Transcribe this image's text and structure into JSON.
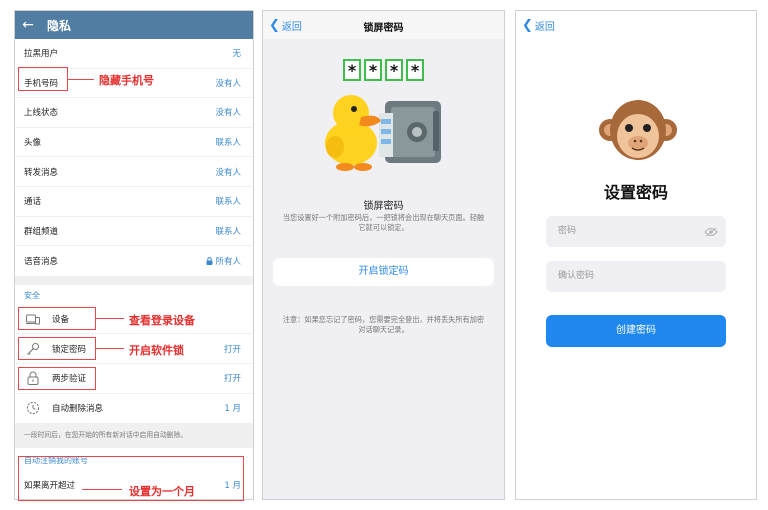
{
  "panel1": {
    "title": "隐私",
    "rows": [
      {
        "label": "拉黑用户",
        "value": "无"
      },
      {
        "label": "手机号码",
        "value": "没有人"
      },
      {
        "label": "上线状态",
        "value": "没有人"
      },
      {
        "label": "头像",
        "value": "联系人"
      },
      {
        "label": "转发消息",
        "value": "没有人"
      },
      {
        "label": "通话",
        "value": "联系人"
      },
      {
        "label": "群组频道",
        "value": "联系人"
      },
      {
        "label": "语音消息",
        "value": "所有人"
      }
    ],
    "security": {
      "title": "安全",
      "items": [
        {
          "label": "设备",
          "value": ""
        },
        {
          "label": "锁定密码",
          "value": "打开"
        },
        {
          "label": "两步验证",
          "value": "打开"
        },
        {
          "label": "自动删除消息",
          "value": "1 月"
        }
      ],
      "note": "一段时间后，在您开始的所有新对话中启用自动删除。"
    },
    "auto_delete": {
      "title": "自动注销我的账号",
      "label": "如果离开超过",
      "value": "1 月"
    },
    "annotations": {
      "hide_phone": "隐藏手机号",
      "check_devices": "查看登录设备",
      "enable_lock": "开启软件锁",
      "set_month": "设置为一个月"
    }
  },
  "panel2": {
    "back": "返回",
    "title": "锁屏密码",
    "pin_chars": [
      "*",
      "*",
      "*",
      "*"
    ],
    "heading": "锁屏密码",
    "description": "当您设置好一个附加密码后，一把锁将会出现在聊天页面。轻触它就可以锁定。",
    "button": "开启锁定码",
    "note": "注意：如果您忘记了密码，您需要完全登出，并将丢失所有加密对话聊天记录。"
  },
  "panel3": {
    "back": "返回",
    "title": "设置密码",
    "password_placeholder": "密码",
    "confirm_placeholder": "确认密码",
    "button": "创建密码"
  },
  "colors": {
    "header_blue": "#517da2",
    "link_blue": "#3a88d0",
    "annotation_red": "#e5302f",
    "primary_button": "#1e88ef",
    "pin_border": "#3fbe4c"
  }
}
